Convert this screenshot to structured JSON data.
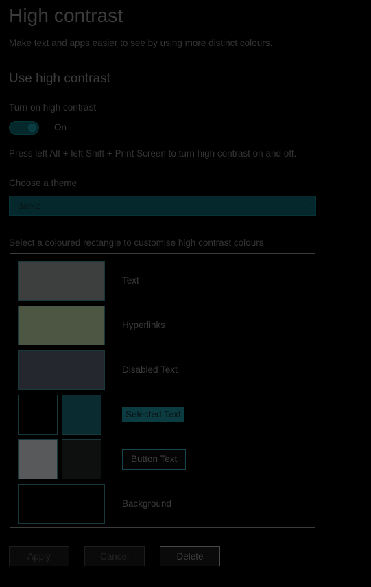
{
  "header": {
    "title": "High contrast",
    "subtitle": "Make text and apps easier to see by using more distinct colours.",
    "section_heading": "Use high contrast"
  },
  "toggle": {
    "label": "Turn on high contrast",
    "state": "On",
    "checked": true,
    "hint": "Press left Alt + left Shift + Print Screen to turn high contrast on and off."
  },
  "theme": {
    "label": "Choose a theme",
    "selected": "dark2",
    "chevron_icon": "chevron-down-icon"
  },
  "swatches": {
    "intro": "Select a coloured rectangle to customise high contrast colours",
    "rows": [
      {
        "label": "Text",
        "style": "plain",
        "cells": [
          "#3d3f3f"
        ]
      },
      {
        "label": "Hyperlinks",
        "style": "plain",
        "cells": [
          "#4d5543"
        ]
      },
      {
        "label": "Disabled Text",
        "style": "plain",
        "cells": [
          "#24272d"
        ]
      },
      {
        "label": "Selected Text",
        "style": "sel",
        "cells": [
          "#000000",
          "#0a2c30"
        ]
      },
      {
        "label": "Button Text",
        "style": "btn",
        "cells": [
          "#58595a",
          "#0d100f"
        ]
      },
      {
        "label": "Background",
        "style": "plain",
        "cells": [
          "#000000"
        ]
      }
    ]
  },
  "actions": {
    "buttons": [
      {
        "label": "Apply",
        "enabled": false
      },
      {
        "label": "Cancel",
        "enabled": false
      },
      {
        "label": "Delete",
        "enabled": true
      }
    ]
  },
  "colors": {
    "page_background": "#000000",
    "accent_teal": "#0a3b40",
    "panel_border": "#3b3b3b",
    "swatch_border": "#17393c"
  }
}
